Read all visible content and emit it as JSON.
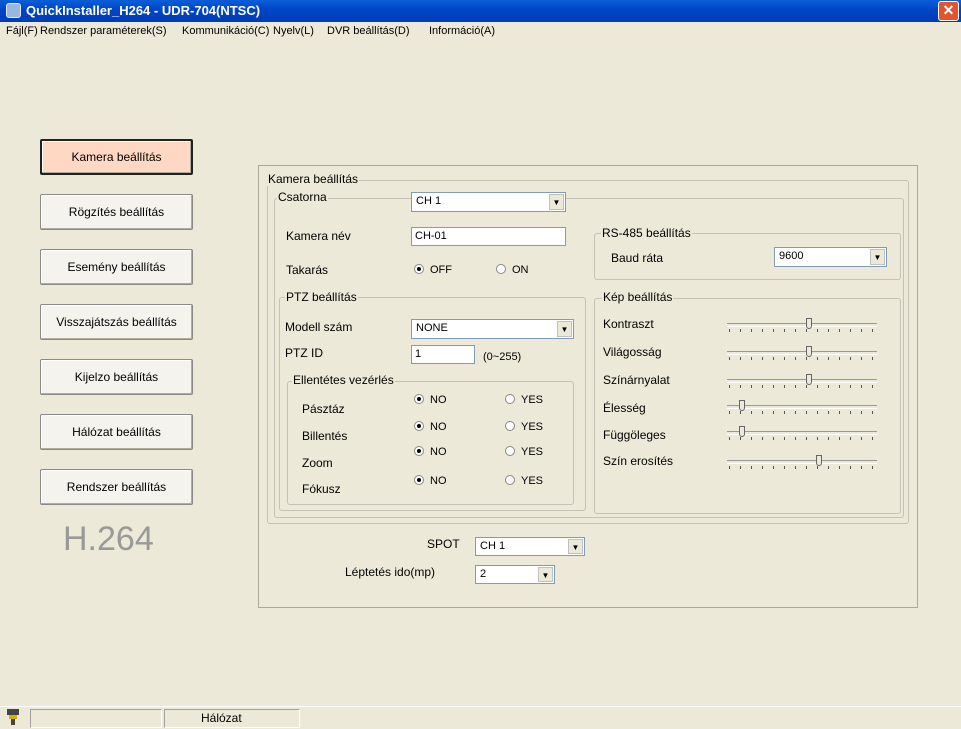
{
  "window": {
    "title": "QuickInstaller_H264 - UDR-704(NTSC)",
    "close": "✕"
  },
  "menu": [
    "Fájl(F)",
    "Rendszer paraméterek(S)",
    "Kommunikáció(C)",
    "Nyelv(L)",
    "DVR beállítás(D)",
    "Információ(A)"
  ],
  "nav": [
    {
      "label": "Kamera beállítás",
      "active": true
    },
    {
      "label": "Rögzítés beállítás",
      "active": false
    },
    {
      "label": "Esemény beállítás",
      "active": false
    },
    {
      "label": "Visszajátszás beállítás",
      "active": false
    },
    {
      "label": "Kijelzo beállítás",
      "active": false
    },
    {
      "label": "Hálózat beállítás",
      "active": false
    },
    {
      "label": "Rendszer beállítás",
      "active": false
    }
  ],
  "logo": "H.264",
  "camera": {
    "group_title": "Kamera beállítás",
    "channel_group": "Csatorna",
    "channel_value": "CH 1",
    "name_label": "Kamera név",
    "name_value": "CH-01",
    "mask_label": "Takarás",
    "mask_off": "OFF",
    "mask_on": "ON",
    "mask_selected": "OFF"
  },
  "ptz": {
    "group_title": "PTZ beállítás",
    "model_label": "Modell szám",
    "model_value": "NONE",
    "id_label": "PTZ ID",
    "id_value": "1",
    "id_range": "(0~255)",
    "reverse_group": "Ellentétes vezérlés",
    "no": "NO",
    "yes": "YES",
    "rows": [
      {
        "label": "Pásztáz",
        "selected": "NO"
      },
      {
        "label": "Billentés",
        "selected": "NO"
      },
      {
        "label": "Zoom",
        "selected": "NO"
      },
      {
        "label": "Fókusz",
        "selected": "NO"
      }
    ]
  },
  "rs485": {
    "group_title": "RS-485 beállítás",
    "baud_label": "Baud ráta",
    "baud_value": "9600"
  },
  "image": {
    "group_title": "Kép beállítás",
    "sliders": [
      {
        "label": "Kontraszt",
        "level": 0.55
      },
      {
        "label": "Világosság",
        "level": 0.55
      },
      {
        "label": "Színárnyalat",
        "level": 0.55
      },
      {
        "label": "Élesség",
        "level": 0.08
      },
      {
        "label": "Függöleges",
        "level": 0.08
      },
      {
        "label": "Szín erosítés",
        "level": 0.62
      }
    ]
  },
  "spot": {
    "label": "SPOT",
    "value": "CH 1",
    "step_label": "Léptetés ido(mp)",
    "step_value": "2"
  },
  "status": {
    "network": "Hálózat"
  }
}
